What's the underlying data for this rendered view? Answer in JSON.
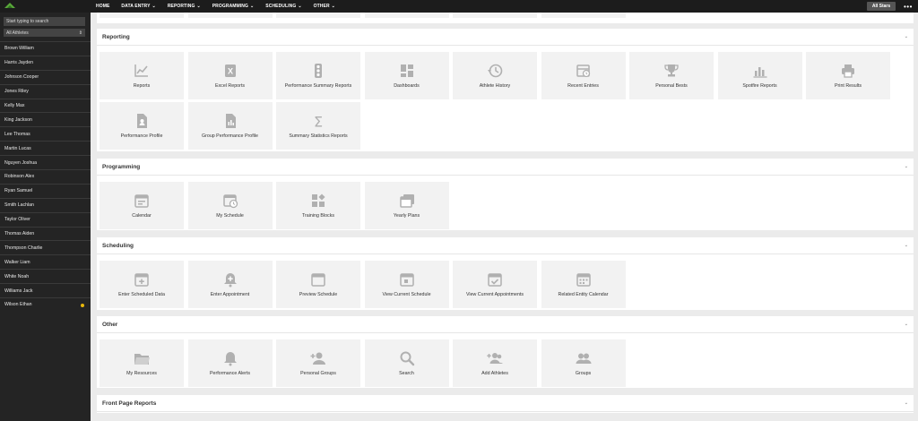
{
  "nav": {
    "items": [
      {
        "label": "HOME",
        "has_menu": false
      },
      {
        "label": "DATA ENTRY",
        "has_menu": true
      },
      {
        "label": "REPORTING",
        "has_menu": true
      },
      {
        "label": "PROGRAMMING",
        "has_menu": true
      },
      {
        "label": "SCHEDULING",
        "has_menu": true
      },
      {
        "label": "OTHER",
        "has_menu": true
      }
    ],
    "group_label": "All Stars",
    "more_label": "•••",
    "chevron": "⌄"
  },
  "sidebar": {
    "search_placeholder": "Start typing to search",
    "filter_value": "All Athletes",
    "filter_arrow": "⇕",
    "athletes": [
      {
        "name": "Brown William"
      },
      {
        "name": "Harris Jayden"
      },
      {
        "name": "Johnson Cooper"
      },
      {
        "name": "Jones Riley"
      },
      {
        "name": "Kelly Max"
      },
      {
        "name": "King Jackson"
      },
      {
        "name": "Lee Thomas"
      },
      {
        "name": "Martin Lucas"
      },
      {
        "name": "Nguyen Joshua"
      },
      {
        "name": "Robinson Alex"
      },
      {
        "name": "Ryan Samuel"
      },
      {
        "name": "Smith Lachlan"
      },
      {
        "name": "Taylor Oliver"
      },
      {
        "name": "Thomas Aiden"
      },
      {
        "name": "Thompson Charlie"
      },
      {
        "name": "Walker Liam"
      },
      {
        "name": "White Noah"
      },
      {
        "name": "Williams Jack"
      },
      {
        "name": "Wilson Ethan",
        "flag": true
      }
    ],
    "flag_color": "#e8b70b"
  },
  "sections": [
    {
      "title": "Reporting",
      "tiles": [
        {
          "label": "Reports",
          "icon": "line-chart-icon"
        },
        {
          "label": "Excel Reports",
          "icon": "excel-icon"
        },
        {
          "label": "Performance Summary Reports",
          "icon": "traffic-light-icon"
        },
        {
          "label": "Dashboards",
          "icon": "dashboard-icon"
        },
        {
          "label": "Athlete History",
          "icon": "history-icon"
        },
        {
          "label": "Recent Entries",
          "icon": "recent-entries-icon"
        },
        {
          "label": "Personal Bests",
          "icon": "trophy-icon"
        },
        {
          "label": "Spotfire Reports",
          "icon": "bar-chart-icon"
        },
        {
          "label": "Print Results",
          "icon": "printer-icon"
        },
        {
          "label": "Performance Profile",
          "icon": "profile-document-icon"
        },
        {
          "label": "Group Performance Profile",
          "icon": "group-document-icon"
        },
        {
          "label": "Summary Statistics Reports",
          "icon": "sigma-icon"
        }
      ]
    },
    {
      "title": "Programming",
      "tiles": [
        {
          "label": "Calendar",
          "icon": "calendar-icon"
        },
        {
          "label": "My Schedule",
          "icon": "calendar-clock-icon"
        },
        {
          "label": "Training Blocks",
          "icon": "blocks-icon"
        },
        {
          "label": "Yearly Plans",
          "icon": "yearly-plan-icon"
        }
      ]
    },
    {
      "title": "Scheduling",
      "tiles": [
        {
          "label": "Enter Scheduled Data",
          "icon": "calendar-plus-icon"
        },
        {
          "label": "Enter Appointment",
          "icon": "bell-plus-icon"
        },
        {
          "label": "Preview Schedule",
          "icon": "calendar-blank-icon"
        },
        {
          "label": "View Current Schedule",
          "icon": "calendar-day-icon"
        },
        {
          "label": "View Current Appointments",
          "icon": "calendar-check-icon"
        },
        {
          "label": "Related Entity Calendar",
          "icon": "calendar-grid-icon"
        }
      ]
    },
    {
      "title": "Other",
      "tiles": [
        {
          "label": "My Resources",
          "icon": "folder-icon"
        },
        {
          "label": "Performance Alerts",
          "icon": "bell-icon"
        },
        {
          "label": "Personal Groups",
          "icon": "person-plus-icon"
        },
        {
          "label": "Search",
          "icon": "search-icon"
        },
        {
          "label": "Add Athletes",
          "icon": "group-add-icon"
        },
        {
          "label": "Groups",
          "icon": "group-icon"
        }
      ]
    },
    {
      "title": "Front Page Reports",
      "tiles": []
    }
  ],
  "caret": "⌄",
  "colors": {
    "topbar": "#1c1c1c",
    "sidebar": "#242424",
    "icon": "#b0b0b0",
    "tile": "#f2f2f2"
  }
}
